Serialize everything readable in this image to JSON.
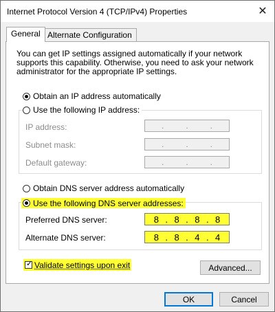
{
  "window": {
    "title": "Internet Protocol Version 4 (TCP/IPv4) Properties",
    "close_glyph": "✕"
  },
  "tabs": [
    {
      "label": "General",
      "active": true
    },
    {
      "label": "Alternate Configuration",
      "active": false
    }
  ],
  "intro_text": "You can get IP settings assigned automatically if your network supports this capability. Otherwise, you need to ask your network administrator for the appropriate IP settings.",
  "ip": {
    "auto_label": "Obtain an IP address automatically",
    "manual_label": "Use the following IP address:",
    "selected": "auto",
    "fields": [
      {
        "label": "IP address:",
        "value": ". . ."
      },
      {
        "label": "Subnet mask:",
        "value": ". . ."
      },
      {
        "label": "Default gateway:",
        "value": ". . ."
      }
    ]
  },
  "dns": {
    "auto_label": "Obtain DNS server address automatically",
    "manual_label": "Use the following DNS server addresses:",
    "selected": "manual",
    "preferred": {
      "label": "Preferred DNS server:",
      "octets": [
        "8",
        "8",
        "8",
        "8"
      ]
    },
    "alternate": {
      "label": "Alternate DNS server:",
      "octets": [
        "8",
        "8",
        "4",
        "4"
      ]
    }
  },
  "validate": {
    "label": "Validate settings upon exit",
    "checked": true
  },
  "buttons": {
    "advanced": "Advanced...",
    "ok": "OK",
    "cancel": "Cancel"
  },
  "colors": {
    "highlight": "#ffff33",
    "focus_border": "#0078d7"
  }
}
